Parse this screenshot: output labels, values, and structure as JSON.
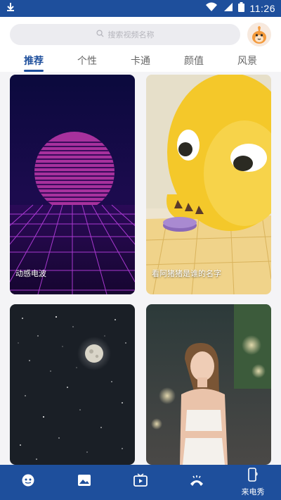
{
  "status_bar": {
    "time": "11:26"
  },
  "search": {
    "placeholder": "搜索视频名称"
  },
  "tabs": [
    {
      "label": "推荐",
      "active": true
    },
    {
      "label": "个性",
      "active": false
    },
    {
      "label": "卡通",
      "active": false
    },
    {
      "label": "颜值",
      "active": false
    },
    {
      "label": "风景",
      "active": false
    }
  ],
  "cards": [
    {
      "caption": "动感电波"
    },
    {
      "caption": "看阿猪猪是谁的名字"
    },
    {
      "caption": ""
    },
    {
      "caption": ""
    }
  ],
  "bottom_nav": [
    {
      "label": "",
      "icon": "face-icon"
    },
    {
      "label": "",
      "icon": "image-icon"
    },
    {
      "label": "",
      "icon": "tv-icon"
    },
    {
      "label": "",
      "icon": "phone-ring-icon"
    },
    {
      "label": "来电秀",
      "icon": "phone-device-icon"
    }
  ],
  "colors": {
    "primary": "#1e4f9c",
    "background": "#f4f4f6"
  }
}
